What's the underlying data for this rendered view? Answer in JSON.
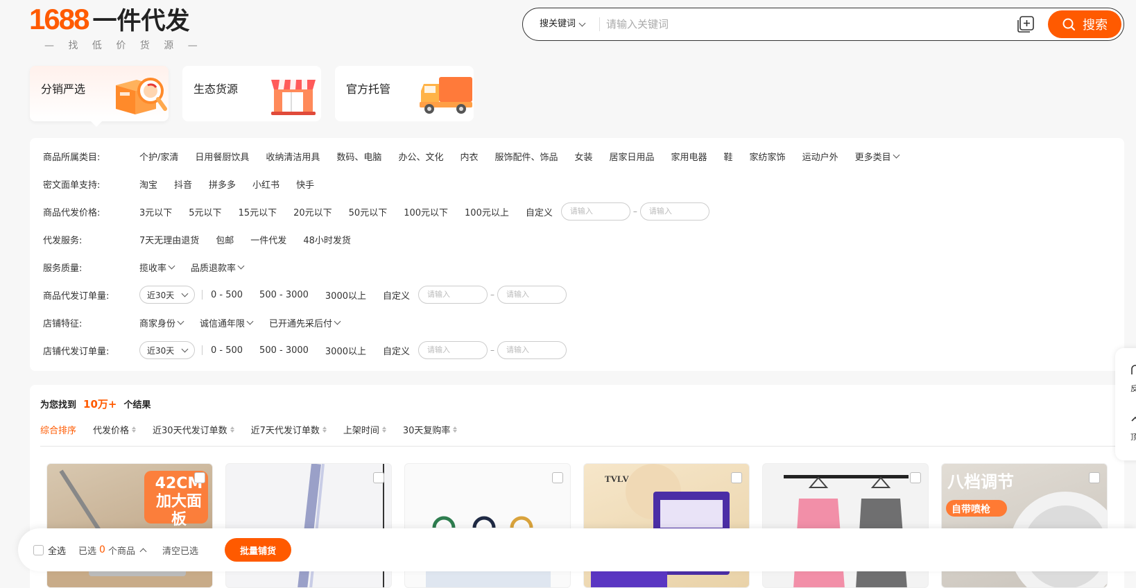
{
  "logo": {
    "num": "1688",
    "text": "一件代发",
    "sub": "— 找 低 价 货 源 —"
  },
  "search": {
    "type": "搜关键词",
    "placeholder": "请输入关键词",
    "button": "搜索"
  },
  "cards": [
    {
      "label": "分销严选"
    },
    {
      "label": "生态货源"
    },
    {
      "label": "官方托管"
    }
  ],
  "filters": {
    "category": {
      "label": "商品所属类目:",
      "options": [
        "个护/家清",
        "日用餐厨饮具",
        "收纳清洁用具",
        "数码、电脑",
        "办公、文化",
        "内衣",
        "服饰配件、饰品",
        "女装",
        "居家日用品",
        "家用电器",
        "鞋",
        "家纺家饰",
        "运动户外"
      ],
      "more": "更多类目"
    },
    "waybill": {
      "label": "密文面单支持:",
      "options": [
        "淘宝",
        "抖音",
        "拼多多",
        "小红书",
        "快手"
      ]
    },
    "price": {
      "label": "商品代发价格:",
      "options": [
        "3元以下",
        "5元以下",
        "15元以下",
        "20元以下",
        "50元以下",
        "100元以下",
        "100元以上"
      ],
      "custom": "自定义",
      "placeholder": "请输入",
      "dash": "–"
    },
    "service": {
      "label": "代发服务:",
      "options": [
        "7天无理由退货",
        "包邮",
        "一件代发",
        "48小时发货"
      ]
    },
    "quality": {
      "label": "服务质量:",
      "options": [
        "揽收率",
        "品质退款率"
      ]
    },
    "product_orders": {
      "label": "商品代发订单量:",
      "period": "近30天",
      "options": [
        "0 - 500",
        "500 - 3000",
        "3000以上"
      ],
      "custom": "自定义",
      "placeholder": "请输入",
      "dash": "–"
    },
    "shop": {
      "label": "店铺特征:",
      "options": [
        "商家身份",
        "诚信通年限",
        "已开通先采后付"
      ]
    },
    "shop_orders": {
      "label": "店铺代发订单量:",
      "period": "近30天",
      "options": [
        "0 - 500",
        "500 - 3000",
        "3000以上"
      ],
      "custom": "自定义",
      "placeholder": "请输入",
      "dash": "–"
    }
  },
  "results": {
    "prefix": "为您找到",
    "count": "10万+",
    "suffix": "个结果",
    "sorts": [
      "综合排序",
      "代发价格",
      "近30天代发订单数",
      "近7天代发订单数",
      "上架时间",
      "30天复购率"
    ]
  },
  "products": [
    {
      "tag": "42CM\n加大面板"
    },
    {
      "tag": ""
    },
    {
      "tag": ""
    },
    {
      "tag": "TVLV"
    },
    {
      "tag": ""
    },
    {
      "tag": "八档调节",
      "tag2": "自带喷枪"
    }
  ],
  "bottom_bar": {
    "select_all": "全选",
    "selected_prefix": "已选",
    "selected_count": "0",
    "selected_suffix": "个商品",
    "clear": "清空已选",
    "button": "批量铺货"
  },
  "side": {
    "item1": "反",
    "item2": "顶"
  },
  "colors": {
    "accent": "#ff5a00"
  }
}
